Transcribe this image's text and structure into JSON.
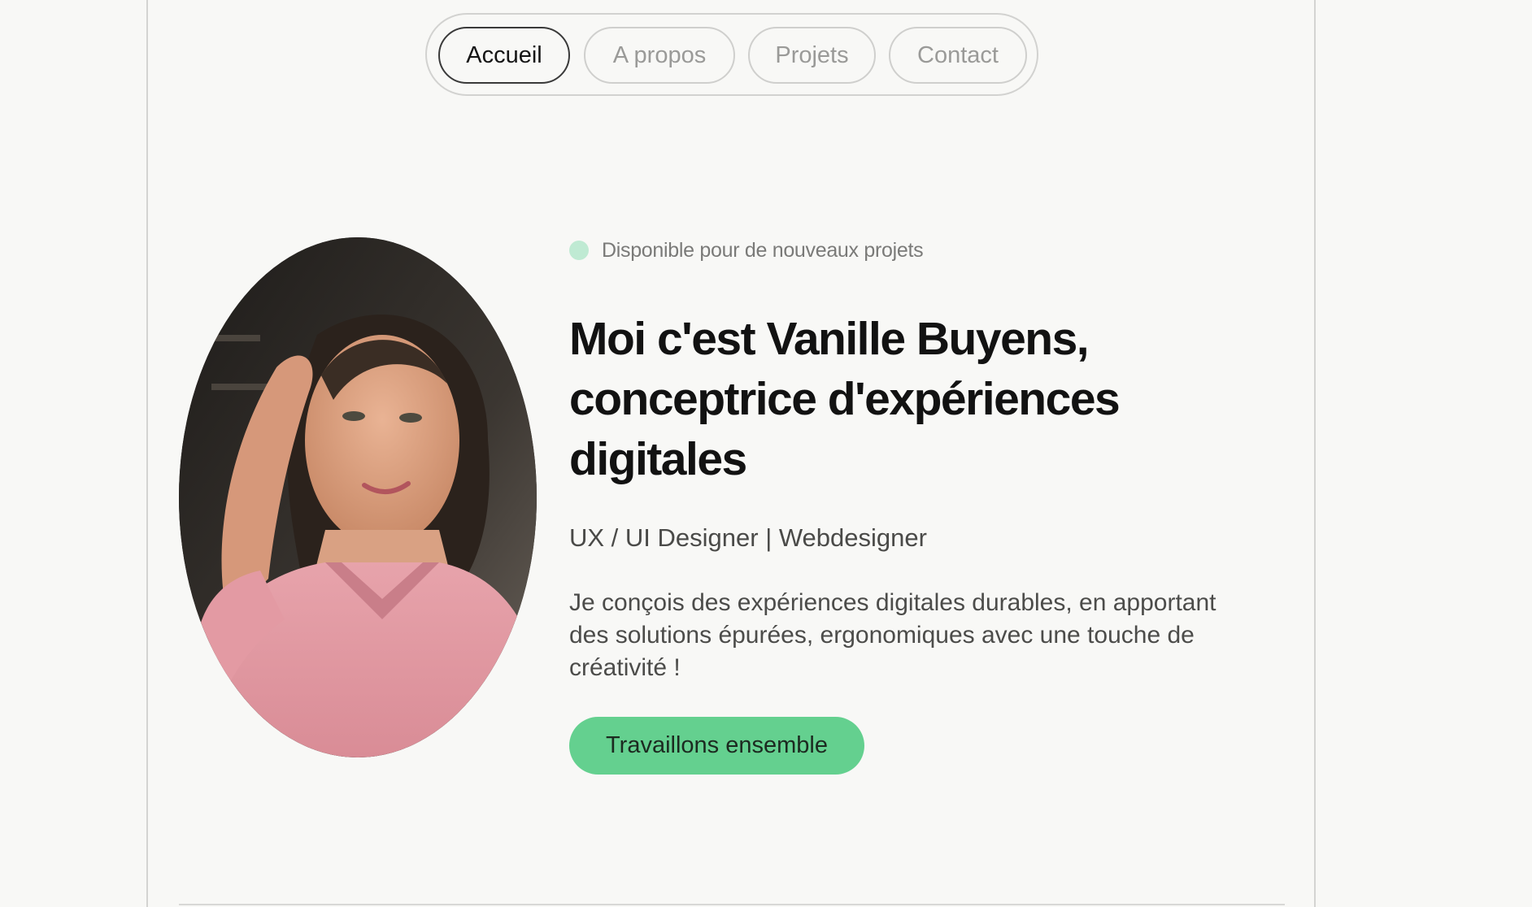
{
  "nav": {
    "items": [
      {
        "label": "Accueil",
        "active": true
      },
      {
        "label": "A propos",
        "active": false
      },
      {
        "label": "Projets",
        "active": false
      },
      {
        "label": "Contact",
        "active": false
      }
    ]
  },
  "hero": {
    "status_text": "Disponible pour de nouveaux projets",
    "status_color": "#bfead3",
    "title_lines": [
      "Moi c'est Vanille Buyens,",
      "conceptrice d'expériences",
      "digitales"
    ],
    "role": "UX / UI Designer | Webdesigner",
    "description_lines": [
      "Je conçois des expériences digitales durables, en apportant",
      "des solutions épurées, ergonomiques avec une touche de",
      "créativité !"
    ],
    "cta_label": "Travaillons ensemble",
    "cta_color": "#64d08f"
  },
  "icons": {
    "status": "status-dot-icon"
  }
}
